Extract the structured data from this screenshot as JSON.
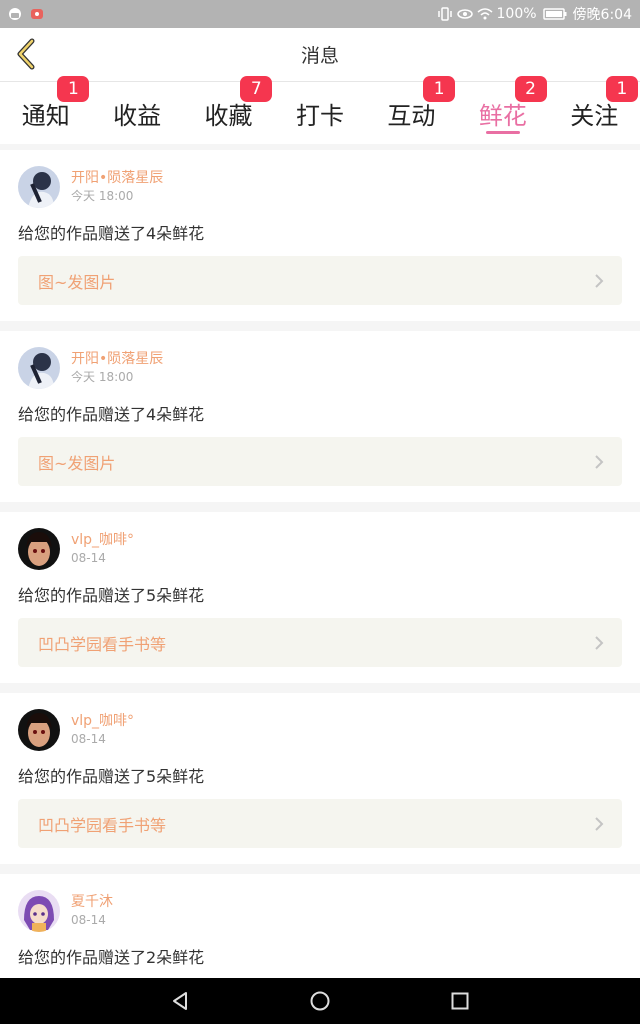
{
  "status_bar": {
    "battery": "100%",
    "time": "傍晚6:04"
  },
  "header": {
    "title": "消息"
  },
  "tabs": [
    {
      "label": "通知",
      "badge": "1"
    },
    {
      "label": "收益",
      "badge": ""
    },
    {
      "label": "收藏",
      "badge": "7"
    },
    {
      "label": "打卡",
      "badge": ""
    },
    {
      "label": "互动",
      "badge": "1"
    },
    {
      "label": "鲜花",
      "badge": "2",
      "active": true
    },
    {
      "label": "关注",
      "badge": "1"
    }
  ],
  "feed": [
    {
      "username": "开阳•陨落星辰",
      "time": "今天 18:00",
      "message": "给您的作品赠送了4朵鲜花",
      "work": "图~发图片"
    },
    {
      "username": "开阳•陨落星辰",
      "time": "今天 18:00",
      "message": "给您的作品赠送了4朵鲜花",
      "work": "图~发图片"
    },
    {
      "username": "vlp_咖啡°",
      "time": "08-14",
      "message": "给您的作品赠送了5朵鲜花",
      "work": "凹凸学园看手书等"
    },
    {
      "username": "vlp_咖啡°",
      "time": "08-14",
      "message": "给您的作品赠送了5朵鲜花",
      "work": "凹凸学园看手书等"
    },
    {
      "username": "夏千沐",
      "time": "08-14",
      "message": "给您的作品赠送了2朵鲜花",
      "work": ""
    }
  ],
  "colors": {
    "accent": "#e96fa3",
    "username": "#f0a174",
    "badge": "#f5364f"
  }
}
